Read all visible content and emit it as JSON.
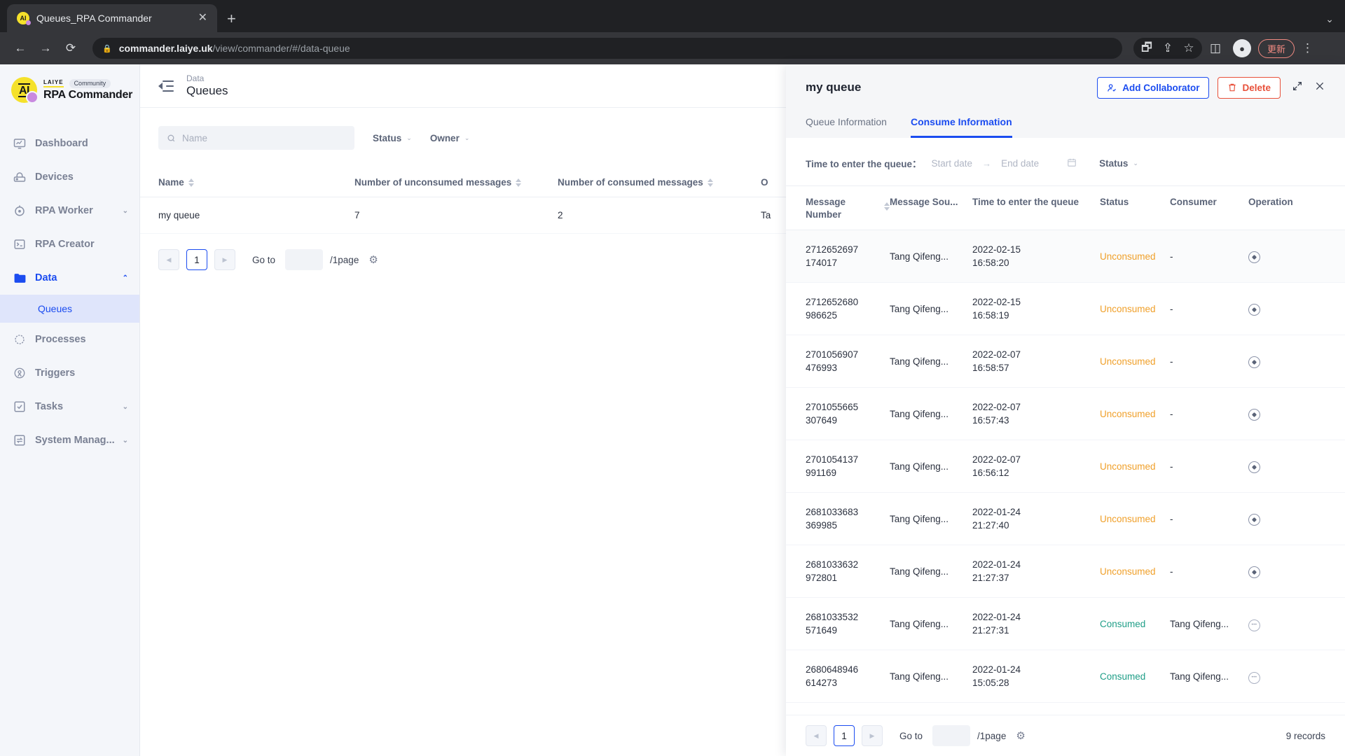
{
  "browser": {
    "tab": {
      "title": "Queues_RPA Commander",
      "favicon_icon": "ai-logo-icon",
      "close_icon": "close-icon"
    },
    "new_tab_icon": "plus-icon",
    "window_chevron_icon": "chevron-down-icon",
    "back_icon": "back-arrow-icon",
    "forward_icon": "forward-arrow-icon",
    "reload_icon": "reload-icon",
    "lock_icon": "lock-icon",
    "url_domain": "commander.laiye.uk",
    "url_path": "/view/commander/#/data-queue",
    "translate_icon": "translate-icon",
    "share_icon": "share-icon",
    "bookmark_icon": "star-icon",
    "sidepanel_icon": "side-panel-icon",
    "profile_icon": "profile-avatar-icon",
    "update_label": "更新",
    "menu_icon": "kebab-menu-icon"
  },
  "sidebar": {
    "brand": {
      "mark": "AI",
      "vendor": "LAIYE",
      "badge": "Community",
      "name": "RPA Commander"
    },
    "items": [
      {
        "label": "Dashboard",
        "icon": "dashboard-monitor-icon",
        "expandable": false,
        "active": false
      },
      {
        "label": "Devices",
        "icon": "device-icon",
        "expandable": false,
        "active": false
      },
      {
        "label": "RPA Worker",
        "icon": "robot-icon",
        "expandable": true,
        "active": false
      },
      {
        "label": "RPA Creator",
        "icon": "terminal-icon",
        "expandable": false,
        "active": false
      },
      {
        "label": "Data",
        "icon": "folder-icon",
        "expandable": true,
        "active": true
      },
      {
        "label": "Processes",
        "icon": "processes-icon",
        "expandable": false,
        "active": false
      },
      {
        "label": "Triggers",
        "icon": "trigger-icon",
        "expandable": false,
        "active": false
      },
      {
        "label": "Tasks",
        "icon": "checkbox-task-icon",
        "expandable": true,
        "active": false
      },
      {
        "label": "System Manag...",
        "icon": "system-transfer-icon",
        "expandable": true,
        "active": false
      }
    ],
    "sub_item": {
      "label": "Queues"
    }
  },
  "main": {
    "collapse_icon": "collapse-sidebar-icon",
    "breadcrumb_parent": "Data",
    "page_title": "Queues",
    "search": {
      "placeholder": "Name",
      "icon": "search-icon"
    },
    "filters": [
      {
        "label": "Status"
      },
      {
        "label": "Owner"
      }
    ],
    "table": {
      "columns": [
        "Name",
        "Number of unconsumed messages",
        "Number of consumed messages",
        "O"
      ],
      "rows": [
        {
          "name": "my queue",
          "unconsumed": "7",
          "consumed": "2",
          "owner": "Ta"
        }
      ]
    },
    "pager": {
      "prev_icon": "chevron-left-icon",
      "next_icon": "chevron-right-icon",
      "current_page": "1",
      "goto_label": "Go to",
      "goto_value": "",
      "per_page_label": "/1page",
      "settings_icon": "gear-icon"
    }
  },
  "drawer": {
    "title": "my queue",
    "add_collaborator_label": "Add Collaborator",
    "add_collaborator_icon": "user-check-icon",
    "delete_label": "Delete",
    "delete_icon": "trash-icon",
    "expand_icon": "expand-diagonal-icon",
    "close_icon": "close-x-icon",
    "tabs": [
      {
        "label": "Queue Information",
        "active": false
      },
      {
        "label": "Consume Information",
        "active": true
      }
    ],
    "filters": {
      "time_label": "Time to enter the queue：",
      "start_placeholder": "Start date",
      "range_arrow": "→",
      "end_placeholder": "End date",
      "calendar_icon": "calendar-icon",
      "status_label": "Status",
      "status_caret_icon": "chevron-down-icon"
    },
    "table": {
      "columns": [
        "Message Number",
        "Message Sou...",
        "Time to enter the queue",
        "Status",
        "Consumer",
        "Operation"
      ],
      "rows": [
        {
          "number_1": "2712652697",
          "number_2": "174017",
          "source": "Tang Qifeng...",
          "date": "2022-02-15",
          "time": "16:58:20",
          "status": "Unconsumed",
          "status_kind": "unconsumed",
          "consumer": "-",
          "op_icon": "play-circle-icon"
        },
        {
          "number_1": "2712652680",
          "number_2": "986625",
          "source": "Tang Qifeng...",
          "date": "2022-02-15",
          "time": "16:58:19",
          "status": "Unconsumed",
          "status_kind": "unconsumed",
          "consumer": "-",
          "op_icon": "play-circle-icon"
        },
        {
          "number_1": "2701056907",
          "number_2": "476993",
          "source": "Tang Qifeng...",
          "date": "2022-02-07",
          "time": "16:58:57",
          "status": "Unconsumed",
          "status_kind": "unconsumed",
          "consumer": "-",
          "op_icon": "play-circle-icon"
        },
        {
          "number_1": "2701055665",
          "number_2": "307649",
          "source": "Tang Qifeng...",
          "date": "2022-02-07",
          "time": "16:57:43",
          "status": "Unconsumed",
          "status_kind": "unconsumed",
          "consumer": "-",
          "op_icon": "play-circle-icon"
        },
        {
          "number_1": "2701054137",
          "number_2": "991169",
          "source": "Tang Qifeng...",
          "date": "2022-02-07",
          "time": "16:56:12",
          "status": "Unconsumed",
          "status_kind": "unconsumed",
          "consumer": "-",
          "op_icon": "play-circle-icon"
        },
        {
          "number_1": "2681033683",
          "number_2": "369985",
          "source": "Tang Qifeng...",
          "date": "2022-01-24",
          "time": "21:27:40",
          "status": "Unconsumed",
          "status_kind": "unconsumed",
          "consumer": "-",
          "op_icon": "play-circle-icon"
        },
        {
          "number_1": "2681033632",
          "number_2": "972801",
          "source": "Tang Qifeng...",
          "date": "2022-01-24",
          "time": "21:27:37",
          "status": "Unconsumed",
          "status_kind": "unconsumed",
          "consumer": "-",
          "op_icon": "play-circle-icon"
        },
        {
          "number_1": "2681033532",
          "number_2": "571649",
          "source": "Tang Qifeng...",
          "date": "2022-01-24",
          "time": "21:27:31",
          "status": "Consumed",
          "status_kind": "consumed",
          "consumer": "Tang Qifeng...",
          "op_icon": "more-circle-icon"
        },
        {
          "number_1": "2680648946",
          "number_2": "614273",
          "source": "Tang Qifeng...",
          "date": "2022-01-24",
          "time": "15:05:28",
          "status": "Consumed",
          "status_kind": "consumed",
          "consumer": "Tang Qifeng...",
          "op_icon": "more-circle-icon"
        }
      ]
    },
    "pager": {
      "prev_icon": "chevron-left-icon",
      "next_icon": "chevron-right-icon",
      "current_page": "1",
      "goto_label": "Go to",
      "goto_value": "",
      "per_page_label": "/1page",
      "settings_icon": "gear-icon",
      "records_label": "9 records"
    }
  },
  "colors": {
    "accent": "#1b4cf0",
    "danger": "#e8503a",
    "warning": "#f0a02a",
    "success": "#1f9e87",
    "brand_yellow": "#F5E12B"
  }
}
